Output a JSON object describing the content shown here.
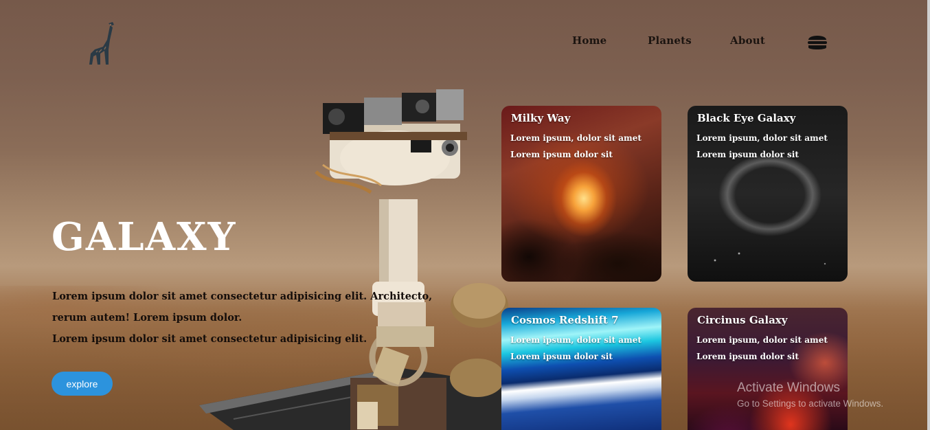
{
  "logo": {
    "icon": "giraffe-icon"
  },
  "nav": {
    "items": [
      {
        "label": "Home"
      },
      {
        "label": "Planets"
      },
      {
        "label": "About"
      }
    ],
    "menu_icon": "hamburger-menu-icon"
  },
  "hero": {
    "title": "GALAXY",
    "lines": [
      "Lorem ipsum dolor sit amet consectetur adipisicing elit. Architecto,",
      "rerum autem! Lorem ipsum dolor.",
      "Lorem ipsum dolor sit amet consectetur adipisicing elit."
    ],
    "button_label": "explore"
  },
  "cards": [
    {
      "title": "Milky Way",
      "line1": "Lorem ipsum, dolor sit amet",
      "line2": "Lorem ipsum dolor sit"
    },
    {
      "title": "Black Eye Galaxy",
      "line1": "Lorem ipsum, dolor sit amet",
      "line2": "Lorem ipsum dolor sit"
    },
    {
      "title": "Cosmos Redshift 7",
      "line1": "Lorem ipsum, dolor sit amet",
      "line2": "Lorem ipsum dolor sit"
    },
    {
      "title": "Circinus Galaxy",
      "line1": "Lorem ipsum, dolor sit amet",
      "line2": "Lorem ipsum dolor sit"
    }
  ],
  "watermark": {
    "title": "Activate Windows",
    "subtitle": "Go to Settings to activate Windows."
  },
  "colors": {
    "accent": "#2c93dd",
    "text_dark": "#140d0a",
    "title": "#ffffff"
  }
}
